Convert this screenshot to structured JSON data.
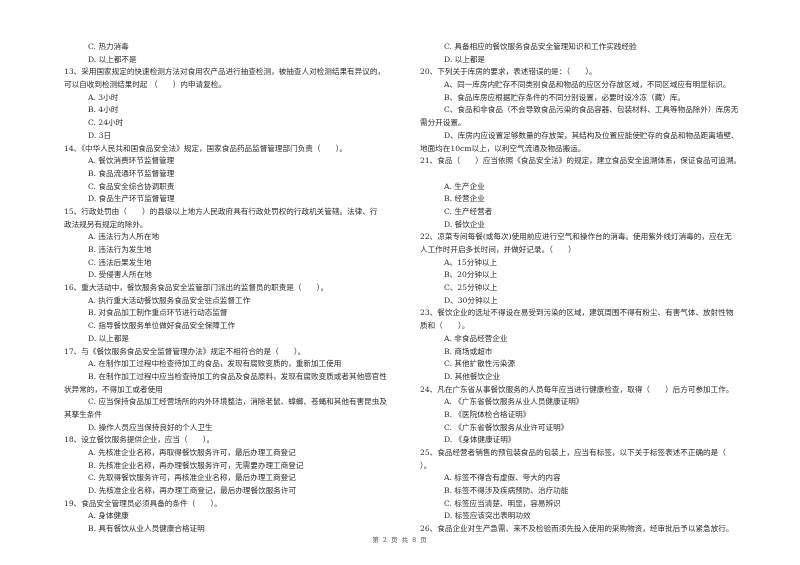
{
  "page": {
    "footer": "第 2 页 共 8 页"
  },
  "left_column": [
    {
      "type": "opt",
      "text": "C. 热力消毒"
    },
    {
      "type": "opt",
      "text": "D. 以上都不是"
    },
    {
      "type": "q",
      "text": "13、采用国家规定的快速检测方法对食用农产品进行抽查检测，被抽查人对检测结果有异议的，"
    },
    {
      "type": "cont",
      "text": "可以自收到检测结果时起 （　　）内申请复检。"
    },
    {
      "type": "opt",
      "text": "A. 3小时"
    },
    {
      "type": "opt",
      "text": "B. 4小时"
    },
    {
      "type": "opt",
      "text": "C. 24小时"
    },
    {
      "type": "opt",
      "text": "D. 3日"
    },
    {
      "type": "q",
      "text": "14、《中华人民共和国食品安全法》规定，国家食品药品监督管理部门负责（　　）。"
    },
    {
      "type": "opt",
      "text": "A. 餐饮消费环节监督管理"
    },
    {
      "type": "opt",
      "text": "B. 食品流通环节监督管理"
    },
    {
      "type": "opt",
      "text": "C. 食品安全综合协调职责"
    },
    {
      "type": "opt",
      "text": "D. 食品生产环节监督管理"
    },
    {
      "type": "q",
      "text": "15、行政处罚由（　　）的县级以上地方人民政府具有行政处罚权的行政机关管辖。法律、行"
    },
    {
      "type": "cont",
      "text": "政法规另有规定的除外。"
    },
    {
      "type": "opt",
      "text": "A. 违法行为人所在地"
    },
    {
      "type": "opt",
      "text": "B. 违法行为发生地"
    },
    {
      "type": "opt",
      "text": "C. 违法后果发生地"
    },
    {
      "type": "opt",
      "text": "D. 受侵害人所在地"
    },
    {
      "type": "q",
      "text": "16、重大活动中，餐饮服务食品安全监管部门派出的监督员的职责是（　　）。"
    },
    {
      "type": "opt",
      "text": "A. 执行重大活动餐饮服务食品安全驻点监督工作"
    },
    {
      "type": "opt",
      "text": "B. 对食品加工制作重点环节进行动态监督"
    },
    {
      "type": "opt",
      "text": "C. 指导餐饮服务单位做好食品安全保障工作"
    },
    {
      "type": "opt",
      "text": "D. 以上都是"
    },
    {
      "type": "q",
      "text": "17、与《餐饮服务食品安全监督管理办法》规定不相符合的是（　　）。"
    },
    {
      "type": "opt",
      "text": "A. 在制作加工过程中检查待加工的食品，发现有腐败变质的，重新加工使用"
    },
    {
      "type": "opt",
      "text": "B. 在制作加工过程中应当检查待加工的食品及食品原料，发现有腐败变质或者其他感官性"
    },
    {
      "type": "cont",
      "text": "状异常的，不得加工或者使用"
    },
    {
      "type": "opt",
      "text": "C. 应当保持食品加工经营场所的内外环境整洁，消除老鼠、蟑螂、苍蝇和其他有害昆虫及"
    },
    {
      "type": "cont",
      "text": "其孳生条件"
    },
    {
      "type": "opt",
      "text": "D. 操作人员应当保持良好的个人卫生"
    },
    {
      "type": "q",
      "text": "18、设立餐饮服务提供企业，应当（　　）。"
    },
    {
      "type": "opt",
      "text": "A. 先核准企业名称，再取得餐饮服务许可，最后办理工商登记"
    },
    {
      "type": "opt",
      "text": "B. 先核准企业名称，再办理餐饮服务许可，无需要办理工商登记"
    },
    {
      "type": "opt",
      "text": "C. 先取得餐饮服务许可，再核准企业名称，最后办理工商登记"
    },
    {
      "type": "opt",
      "text": "D. 先核准企业名称，再办理工商登记，最后办理餐饮服务许可"
    },
    {
      "type": "q",
      "text": "19、食品安全管理员必须具备的条件（　　）。"
    },
    {
      "type": "opt",
      "text": "A. 身体健康"
    },
    {
      "type": "opt",
      "text": "B. 具有餐饮从业人员健康合格证明"
    }
  ],
  "right_column": [
    {
      "type": "opt",
      "text": "C. 具备相应的餐饮服务食品安全管理知识和工作实践经验"
    },
    {
      "type": "opt",
      "text": "D. 以上都是"
    },
    {
      "type": "q",
      "text": "20、下列关于库房的要求，表述错误的是：（　　）。"
    },
    {
      "type": "opt",
      "text": "A、同一库房内贮存不同类别食品和物品的应区分存放区域，不同区域应有明显标识。"
    },
    {
      "type": "opt",
      "text": "B、食品库房应根据贮存条件的不同分别设置，必要时设冷冻（藏）库。"
    },
    {
      "type": "opt",
      "text": "C、食品和非食品（不会导致食品污染的食品容器、包装材料、工具等物品除外）库房无"
    },
    {
      "type": "cont",
      "text": "需分开设置。"
    },
    {
      "type": "opt",
      "text": "D、库房内应设置足够数量的存放架，其结构及位置应能使贮存的食品和物品距离墙壁、"
    },
    {
      "type": "cont",
      "text": "地面均在10cm以上，以利空气流通及物品搬运。"
    },
    {
      "type": "q",
      "text": "21、食品（　　）应当依照《食品安全法》的规定，建立食品安全追溯体系，保证食品可追溯。"
    },
    {
      "type": "blank",
      "text": ""
    },
    {
      "type": "opt",
      "text": "A. 生产企业"
    },
    {
      "type": "opt",
      "text": "B. 经营企业"
    },
    {
      "type": "opt",
      "text": "C. 生产经营者"
    },
    {
      "type": "opt",
      "text": "D. 餐饮企业"
    },
    {
      "type": "q",
      "text": "22、凉菜专间每餐(或每次)使用前应进行空气和操作台的消毒。使用紫外线灯消毒的，应在无"
    },
    {
      "type": "cont",
      "text": "人工作时开启多长时间，并做好记录。（　　）"
    },
    {
      "type": "opt",
      "text": "A、15分钟以上"
    },
    {
      "type": "opt",
      "text": "B、20分钟以上"
    },
    {
      "type": "opt",
      "text": "C、25分钟以上"
    },
    {
      "type": "opt",
      "text": "D、30分钟以上"
    },
    {
      "type": "q",
      "text": "23、餐饮企业的选址不得设在易受到污染的区域，建筑周围不得有粉尘、有害气体、放射性物"
    },
    {
      "type": "cont",
      "text": "质和（　　）。"
    },
    {
      "type": "opt",
      "text": "A. 非食品经营企业"
    },
    {
      "type": "opt",
      "text": "B. 商场或超市"
    },
    {
      "type": "opt",
      "text": "C. 其他扩散性污染源"
    },
    {
      "type": "opt",
      "text": "D. 其他餐饮企业"
    },
    {
      "type": "q",
      "text": "24、凡在广东省从事餐饮服务的人员每年应当进行健康检查，取得（　　）后方可参加工作。"
    },
    {
      "type": "opt",
      "text": "A. 《广东省餐饮服务从业人员健康证明》"
    },
    {
      "type": "opt",
      "text": "B. 《医院体检合格证明》"
    },
    {
      "type": "opt",
      "text": "C. 《广东省餐饮服务从业许可证明》"
    },
    {
      "type": "opt",
      "text": "D. 《身体健康证明》"
    },
    {
      "type": "q",
      "text": "25、食品经营者销售的预包装食品的包装上，应当有标签，以下关于标签表述不正确的是（"
    },
    {
      "type": "cont",
      "text": "）。"
    },
    {
      "type": "opt",
      "text": "A. 标签不得含有虚假、夸大的内容"
    },
    {
      "type": "opt",
      "text": "B. 标签不得涉及疾病预防、治疗功能"
    },
    {
      "type": "opt",
      "text": "C. 标签应当清楚、明显，容易辨识"
    },
    {
      "type": "opt",
      "text": "D. 标签应该突出表明功效"
    },
    {
      "type": "q",
      "text": "26、食品企业对生产急需、来不及检验而须先投入使用的采购物资，经审批后予以紧急放行。"
    }
  ]
}
